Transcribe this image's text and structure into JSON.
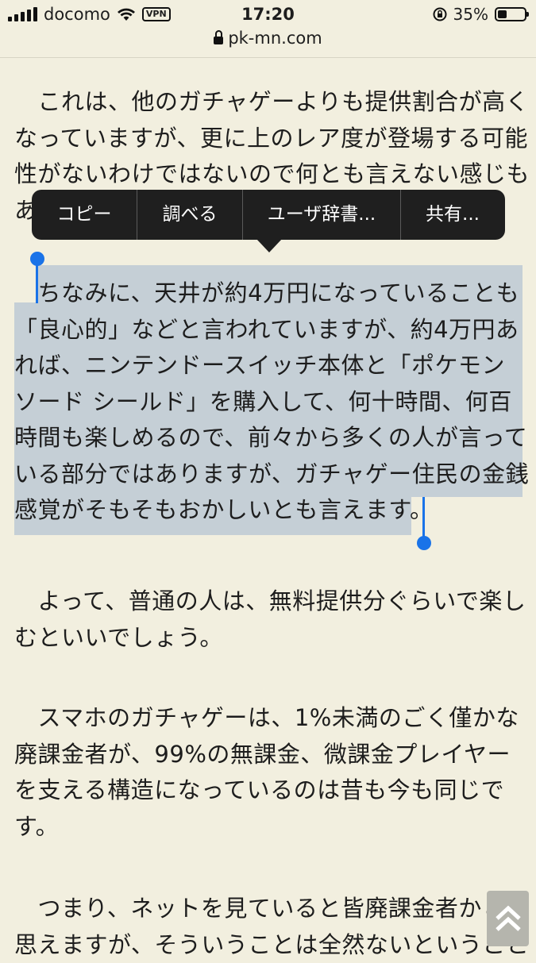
{
  "status_bar": {
    "carrier": "docomo",
    "vpn": "VPN",
    "time": "17:20",
    "battery": "35%",
    "battery_level": 0.35,
    "url": "pk-mn.com"
  },
  "callout_menu": {
    "items": [
      "コピー",
      "調べる",
      "ユーザ辞書...",
      "共有..."
    ]
  },
  "article": {
    "paragraphs": [
      {
        "lines": [
          "　これは、他のガチャゲーよりも提供割合が高く",
          "なっていますが、更に上のレア度が登場する可能",
          "性がないわけではないので何とも言えない感じも",
          "あ"
        ]
      },
      {
        "lines": [
          "　ちなみに、天井が約4万円になっていることも",
          "「良心的」などと言われていますが、約4万円あ",
          "れば、ニンテンドースイッチ本体と「ポケモン",
          "ソード シールド」を購入して、何十時間、何百",
          "時間も楽しめるので、前々から多くの人が言って",
          "いる部分ではありますが、ガチャゲー住民の金銭",
          "感覚がそもそもおかしいとも言えます。"
        ]
      },
      {
        "lines": [
          "　よって、普通の人は、無料提供分ぐらいで楽し",
          "むといいでしょう。"
        ]
      },
      {
        "lines": [
          "　スマホのガチャゲーは、1%未満のごく僅かな",
          "廃課金者が、99%の無課金、微課金プレイヤー",
          "を支える構造になっているのは昔も今も同じで",
          "す。"
        ]
      },
      {
        "lines": [
          "　つまり、ネットを見ていると皆廃課金者かと",
          "思えますが、そういうことは全然ないということ"
        ]
      }
    ]
  },
  "scroll_top_button": {
    "icon": "double-chevron-up-icon"
  }
}
